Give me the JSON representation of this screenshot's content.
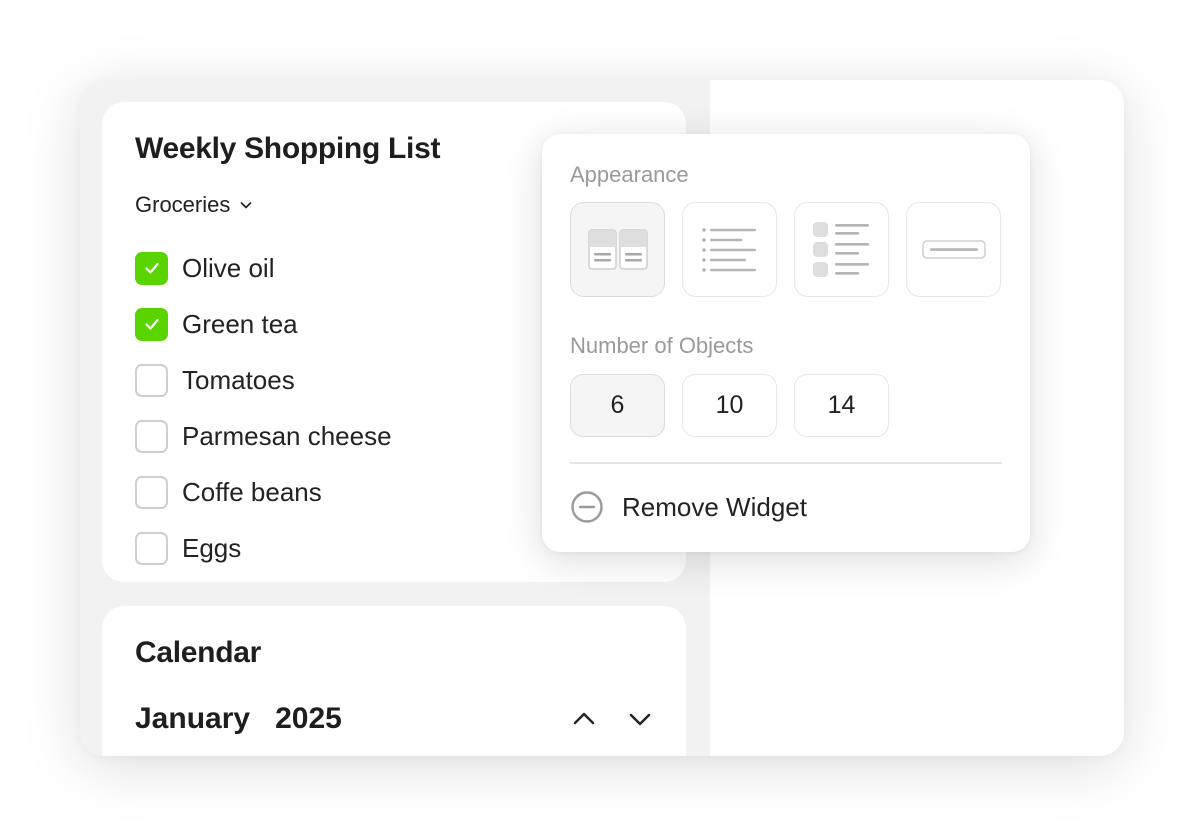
{
  "shopping_list": {
    "title": "Weekly Shopping List",
    "category": "Groceries",
    "items": [
      {
        "label": "Olive oil",
        "checked": true
      },
      {
        "label": "Green tea",
        "checked": true
      },
      {
        "label": "Tomatoes",
        "checked": false
      },
      {
        "label": "Parmesan cheese",
        "checked": false
      },
      {
        "label": "Coffe beans",
        "checked": false
      },
      {
        "label": "Eggs",
        "checked": false
      }
    ]
  },
  "calendar": {
    "title": "Calendar",
    "month": "January",
    "year": "2025"
  },
  "popover": {
    "appearance_label": "Appearance",
    "appearance_options": [
      {
        "name": "two-column-cards",
        "selected": true
      },
      {
        "name": "bullet-list",
        "selected": false
      },
      {
        "name": "icon-list",
        "selected": false
      },
      {
        "name": "compact-bar",
        "selected": false
      }
    ],
    "count_label": "Number of Objects",
    "count_options": [
      {
        "value": "6",
        "selected": true
      },
      {
        "value": "10",
        "selected": false
      },
      {
        "value": "14",
        "selected": false
      }
    ],
    "remove_label": "Remove Widget"
  },
  "colors": {
    "accent_green": "#5ad400",
    "panel_bg": "#f2f2f2",
    "muted_text": "#9a9a9a"
  }
}
